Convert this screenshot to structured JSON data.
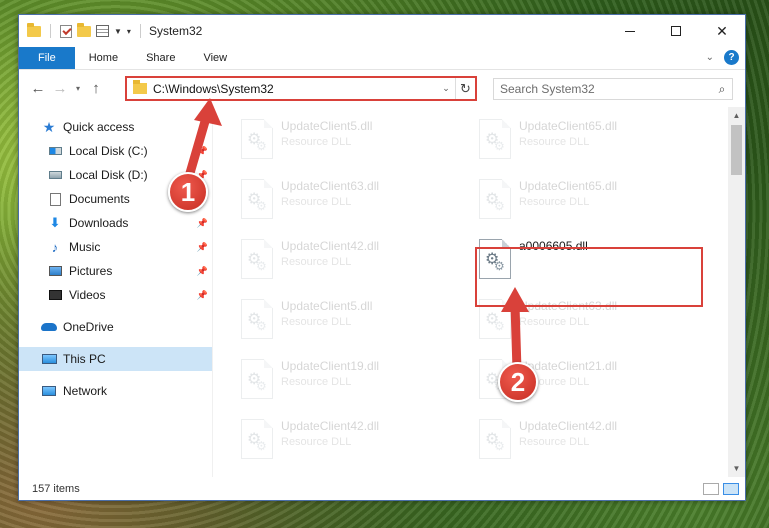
{
  "window": {
    "title": "System32"
  },
  "ribbon": {
    "tabs": [
      "File",
      "Home",
      "Share",
      "View"
    ]
  },
  "address": {
    "path": "C:\\Windows\\System32"
  },
  "search": {
    "placeholder": "Search System32"
  },
  "nav": {
    "quick_access": "Quick access",
    "items": [
      {
        "label": "Local Disk (C:)",
        "icon": "local-disk-c-icon",
        "pinned": true
      },
      {
        "label": "Local Disk (D:)",
        "icon": "local-disk-d-icon",
        "pinned": true
      },
      {
        "label": "Documents",
        "icon": "documents-icon",
        "pinned": true
      },
      {
        "label": "Downloads",
        "icon": "downloads-icon",
        "pinned": true
      },
      {
        "label": "Music",
        "icon": "music-icon",
        "pinned": true
      },
      {
        "label": "Pictures",
        "icon": "pictures-icon",
        "pinned": true
      },
      {
        "label": "Videos",
        "icon": "videos-icon",
        "pinned": true
      }
    ],
    "onedrive": "OneDrive",
    "this_pc": "This PC",
    "network": "Network"
  },
  "files": {
    "left_column": [
      {
        "name": "UpdateClient5.dll",
        "type": "Resource DLL"
      },
      {
        "name": "UpdateClient63.dll",
        "type": "Resource DLL"
      },
      {
        "name": "UpdateClient42.dll",
        "type": "Resource DLL"
      },
      {
        "name": "UpdateClient5.dll",
        "type": "Resource DLL"
      },
      {
        "name": "UpdateClient19.dll",
        "type": "Resource DLL"
      },
      {
        "name": "UpdateClient42.dll",
        "type": "Resource DLL"
      }
    ],
    "right_column": [
      {
        "name": "UpdateClient65.dll",
        "type": "Resource DLL"
      },
      {
        "name": "UpdateClient65.dll",
        "type": "Resource DLL"
      },
      {
        "name": "a0006605.dll",
        "type": ""
      },
      {
        "name": "UpdateClient63.dll",
        "type": "Resource DLL"
      },
      {
        "name": "UpdateClient21.dll",
        "type": "Resource DLL"
      },
      {
        "name": "UpdateClient42.dll",
        "type": "Resource DLL"
      }
    ]
  },
  "status": {
    "item_count": "157 items"
  },
  "annotations": {
    "step1": "1",
    "step2": "2",
    "color": "#d9413a"
  }
}
